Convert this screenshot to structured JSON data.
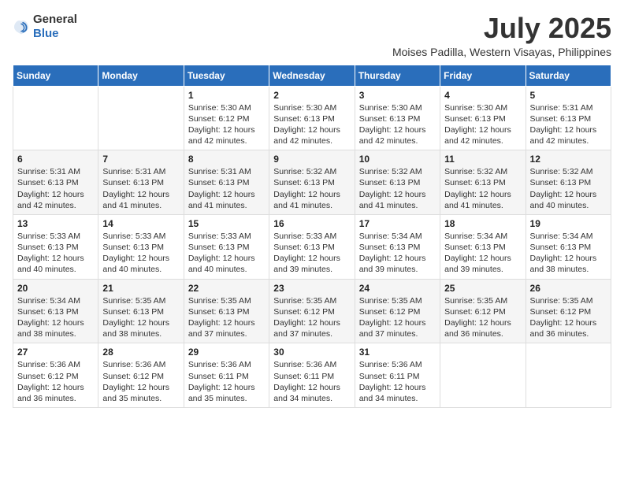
{
  "logo": {
    "text_general": "General",
    "text_blue": "Blue"
  },
  "title": {
    "month_year": "July 2025",
    "location": "Moises Padilla, Western Visayas, Philippines"
  },
  "weekdays": [
    "Sunday",
    "Monday",
    "Tuesday",
    "Wednesday",
    "Thursday",
    "Friday",
    "Saturday"
  ],
  "weeks": [
    [
      {
        "day": "",
        "sunrise": "",
        "sunset": "",
        "daylight": ""
      },
      {
        "day": "",
        "sunrise": "",
        "sunset": "",
        "daylight": ""
      },
      {
        "day": "1",
        "sunrise": "Sunrise: 5:30 AM",
        "sunset": "Sunset: 6:12 PM",
        "daylight": "Daylight: 12 hours and 42 minutes."
      },
      {
        "day": "2",
        "sunrise": "Sunrise: 5:30 AM",
        "sunset": "Sunset: 6:13 PM",
        "daylight": "Daylight: 12 hours and 42 minutes."
      },
      {
        "day": "3",
        "sunrise": "Sunrise: 5:30 AM",
        "sunset": "Sunset: 6:13 PM",
        "daylight": "Daylight: 12 hours and 42 minutes."
      },
      {
        "day": "4",
        "sunrise": "Sunrise: 5:30 AM",
        "sunset": "Sunset: 6:13 PM",
        "daylight": "Daylight: 12 hours and 42 minutes."
      },
      {
        "day": "5",
        "sunrise": "Sunrise: 5:31 AM",
        "sunset": "Sunset: 6:13 PM",
        "daylight": "Daylight: 12 hours and 42 minutes."
      }
    ],
    [
      {
        "day": "6",
        "sunrise": "Sunrise: 5:31 AM",
        "sunset": "Sunset: 6:13 PM",
        "daylight": "Daylight: 12 hours and 42 minutes."
      },
      {
        "day": "7",
        "sunrise": "Sunrise: 5:31 AM",
        "sunset": "Sunset: 6:13 PM",
        "daylight": "Daylight: 12 hours and 41 minutes."
      },
      {
        "day": "8",
        "sunrise": "Sunrise: 5:31 AM",
        "sunset": "Sunset: 6:13 PM",
        "daylight": "Daylight: 12 hours and 41 minutes."
      },
      {
        "day": "9",
        "sunrise": "Sunrise: 5:32 AM",
        "sunset": "Sunset: 6:13 PM",
        "daylight": "Daylight: 12 hours and 41 minutes."
      },
      {
        "day": "10",
        "sunrise": "Sunrise: 5:32 AM",
        "sunset": "Sunset: 6:13 PM",
        "daylight": "Daylight: 12 hours and 41 minutes."
      },
      {
        "day": "11",
        "sunrise": "Sunrise: 5:32 AM",
        "sunset": "Sunset: 6:13 PM",
        "daylight": "Daylight: 12 hours and 41 minutes."
      },
      {
        "day": "12",
        "sunrise": "Sunrise: 5:32 AM",
        "sunset": "Sunset: 6:13 PM",
        "daylight": "Daylight: 12 hours and 40 minutes."
      }
    ],
    [
      {
        "day": "13",
        "sunrise": "Sunrise: 5:33 AM",
        "sunset": "Sunset: 6:13 PM",
        "daylight": "Daylight: 12 hours and 40 minutes."
      },
      {
        "day": "14",
        "sunrise": "Sunrise: 5:33 AM",
        "sunset": "Sunset: 6:13 PM",
        "daylight": "Daylight: 12 hours and 40 minutes."
      },
      {
        "day": "15",
        "sunrise": "Sunrise: 5:33 AM",
        "sunset": "Sunset: 6:13 PM",
        "daylight": "Daylight: 12 hours and 40 minutes."
      },
      {
        "day": "16",
        "sunrise": "Sunrise: 5:33 AM",
        "sunset": "Sunset: 6:13 PM",
        "daylight": "Daylight: 12 hours and 39 minutes."
      },
      {
        "day": "17",
        "sunrise": "Sunrise: 5:34 AM",
        "sunset": "Sunset: 6:13 PM",
        "daylight": "Daylight: 12 hours and 39 minutes."
      },
      {
        "day": "18",
        "sunrise": "Sunrise: 5:34 AM",
        "sunset": "Sunset: 6:13 PM",
        "daylight": "Daylight: 12 hours and 39 minutes."
      },
      {
        "day": "19",
        "sunrise": "Sunrise: 5:34 AM",
        "sunset": "Sunset: 6:13 PM",
        "daylight": "Daylight: 12 hours and 38 minutes."
      }
    ],
    [
      {
        "day": "20",
        "sunrise": "Sunrise: 5:34 AM",
        "sunset": "Sunset: 6:13 PM",
        "daylight": "Daylight: 12 hours and 38 minutes."
      },
      {
        "day": "21",
        "sunrise": "Sunrise: 5:35 AM",
        "sunset": "Sunset: 6:13 PM",
        "daylight": "Daylight: 12 hours and 38 minutes."
      },
      {
        "day": "22",
        "sunrise": "Sunrise: 5:35 AM",
        "sunset": "Sunset: 6:13 PM",
        "daylight": "Daylight: 12 hours and 37 minutes."
      },
      {
        "day": "23",
        "sunrise": "Sunrise: 5:35 AM",
        "sunset": "Sunset: 6:12 PM",
        "daylight": "Daylight: 12 hours and 37 minutes."
      },
      {
        "day": "24",
        "sunrise": "Sunrise: 5:35 AM",
        "sunset": "Sunset: 6:12 PM",
        "daylight": "Daylight: 12 hours and 37 minutes."
      },
      {
        "day": "25",
        "sunrise": "Sunrise: 5:35 AM",
        "sunset": "Sunset: 6:12 PM",
        "daylight": "Daylight: 12 hours and 36 minutes."
      },
      {
        "day": "26",
        "sunrise": "Sunrise: 5:35 AM",
        "sunset": "Sunset: 6:12 PM",
        "daylight": "Daylight: 12 hours and 36 minutes."
      }
    ],
    [
      {
        "day": "27",
        "sunrise": "Sunrise: 5:36 AM",
        "sunset": "Sunset: 6:12 PM",
        "daylight": "Daylight: 12 hours and 36 minutes."
      },
      {
        "day": "28",
        "sunrise": "Sunrise: 5:36 AM",
        "sunset": "Sunset: 6:12 PM",
        "daylight": "Daylight: 12 hours and 35 minutes."
      },
      {
        "day": "29",
        "sunrise": "Sunrise: 5:36 AM",
        "sunset": "Sunset: 6:11 PM",
        "daylight": "Daylight: 12 hours and 35 minutes."
      },
      {
        "day": "30",
        "sunrise": "Sunrise: 5:36 AM",
        "sunset": "Sunset: 6:11 PM",
        "daylight": "Daylight: 12 hours and 34 minutes."
      },
      {
        "day": "31",
        "sunrise": "Sunrise: 5:36 AM",
        "sunset": "Sunset: 6:11 PM",
        "daylight": "Daylight: 12 hours and 34 minutes."
      },
      {
        "day": "",
        "sunrise": "",
        "sunset": "",
        "daylight": ""
      },
      {
        "day": "",
        "sunrise": "",
        "sunset": "",
        "daylight": ""
      }
    ]
  ]
}
